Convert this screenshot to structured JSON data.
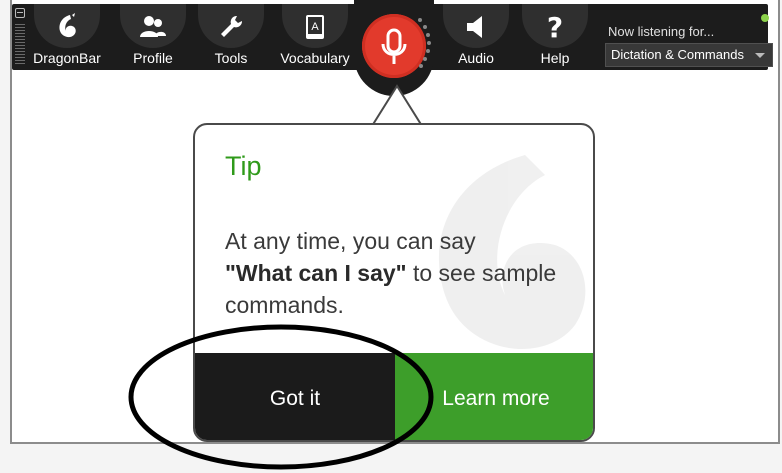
{
  "dragonbar": {
    "items": [
      {
        "label": "DragonBar",
        "icon": "dragon-logo-icon"
      },
      {
        "label": "Profile",
        "icon": "profile-icon"
      },
      {
        "label": "Tools",
        "icon": "wrench-icon"
      },
      {
        "label": "Vocabulary",
        "icon": "vocabulary-icon"
      },
      {
        "label": "Audio",
        "icon": "speaker-icon"
      },
      {
        "label": "Help",
        "icon": "help-icon"
      }
    ],
    "listening_label": "Now listening for...",
    "mode_value": "Dictation & Commands",
    "mic_color": "#e23a2c",
    "status_color": "#8cd24b"
  },
  "tip": {
    "title": "Tip",
    "body_before": "At any time, you can say",
    "body_bold": "\"What can I say\"",
    "body_after": "to see sample commands.",
    "got_it_label": "Got it",
    "learn_more_label": "Learn more",
    "accent_color": "#3d9e2a"
  }
}
